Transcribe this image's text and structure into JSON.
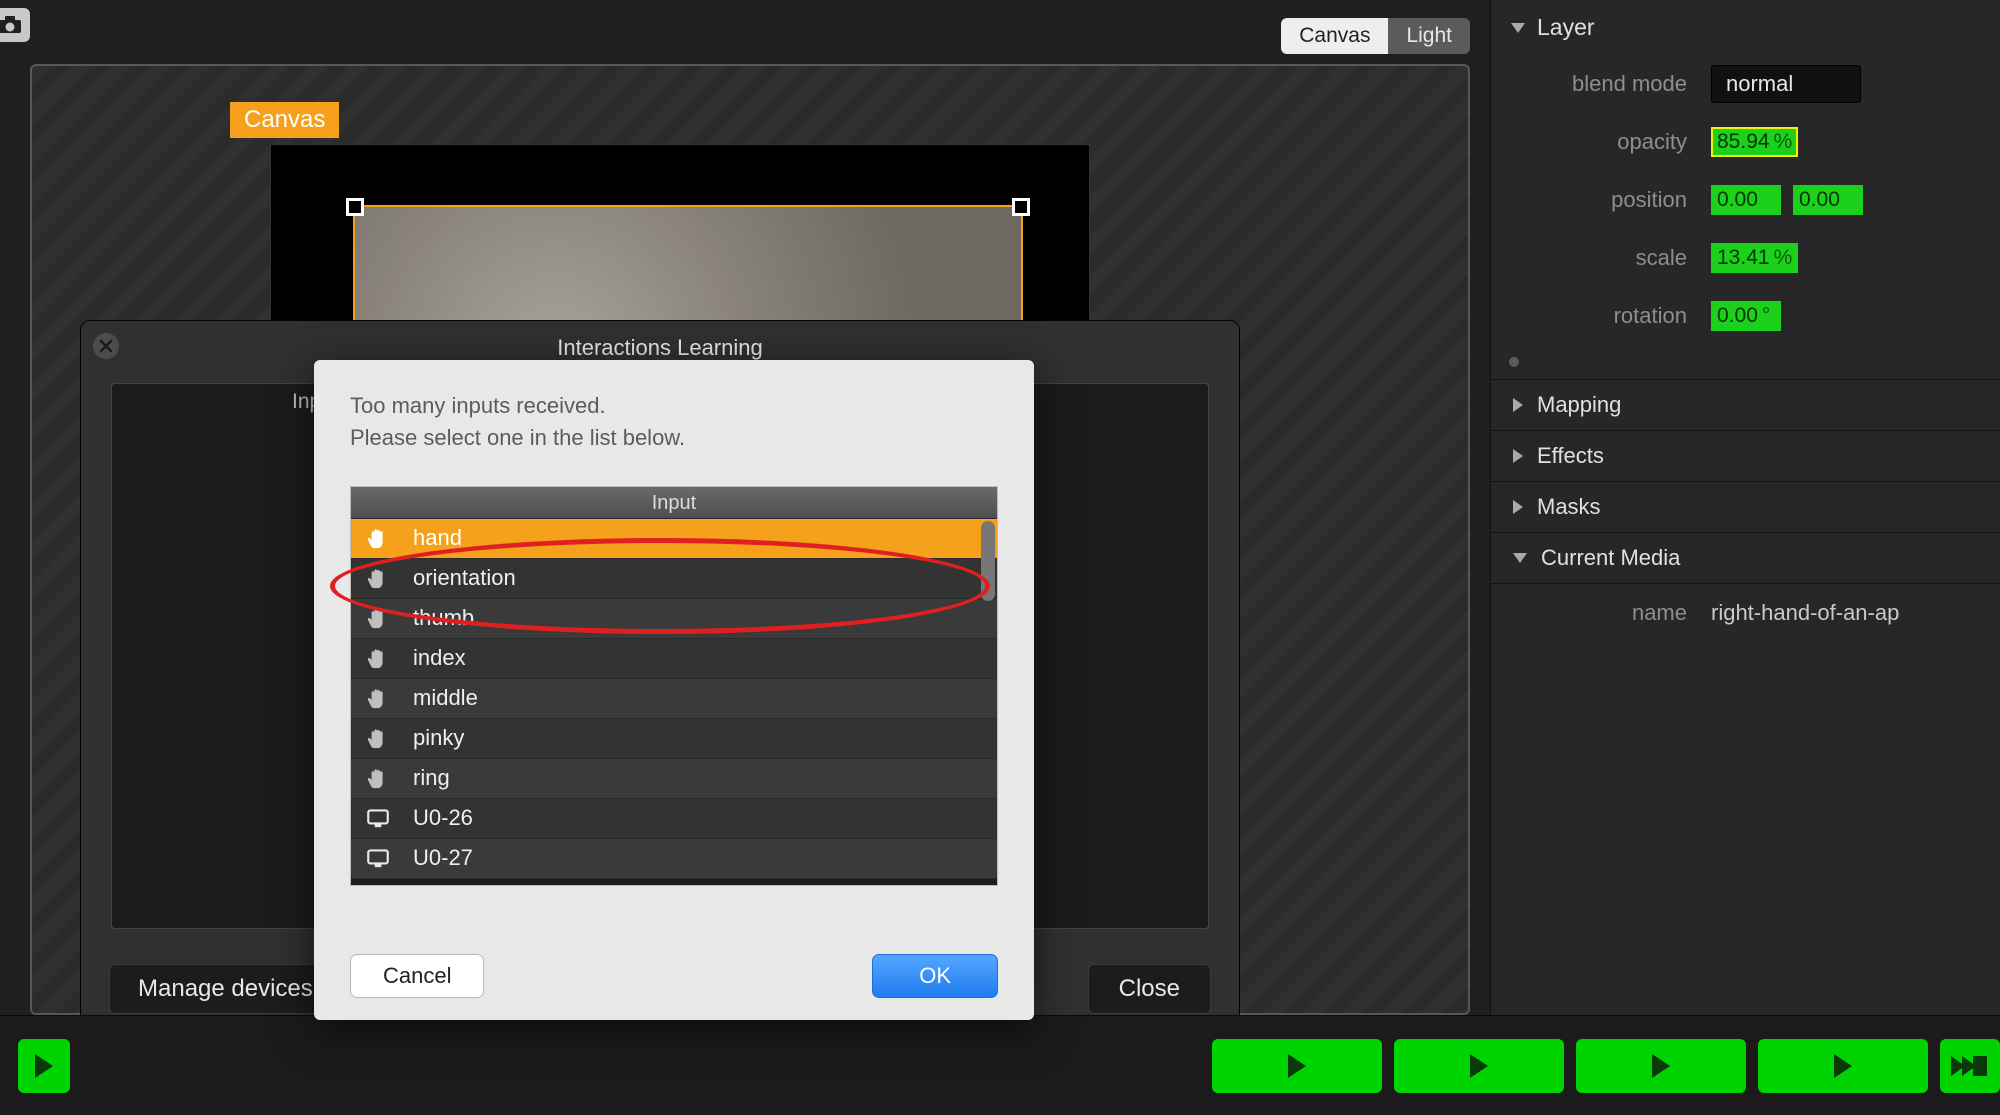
{
  "toolbar": {
    "seg_canvas": "Canvas",
    "seg_light": "Light"
  },
  "canvas": {
    "tag": "Canvas"
  },
  "inspector": {
    "layer_hdr": "Layer",
    "blend_mode_label": "blend mode",
    "blend_mode_value": "normal",
    "opacity_label": "opacity",
    "opacity_value": "85.94",
    "opacity_unit": "%",
    "position_label": "position",
    "position_x": "0.00",
    "position_y": "0.00",
    "scale_label": "scale",
    "scale_value": "13.41",
    "scale_unit": "%",
    "rotation_label": "rotation",
    "rotation_value": "0.00",
    "rotation_unit": "°",
    "mapping": "Mapping",
    "effects": "Effects",
    "masks": "Masks",
    "current_media": "Current Media",
    "media_name_label": "name",
    "media_name_value": "right-hand-of-an-ap"
  },
  "il_panel": {
    "title": "Interactions Learning",
    "col_header": "Inp",
    "manage": "Manage devices ...",
    "close": "Close"
  },
  "modal": {
    "msg_line1": "Too many inputs received.",
    "msg_line2": "Please select one in the list below.",
    "list_header": "Input",
    "cancel": "Cancel",
    "ok": "OK",
    "items": [
      {
        "icon": "hand",
        "label": "hand",
        "selected": true
      },
      {
        "icon": "hand",
        "label": "orientation",
        "selected": false
      },
      {
        "icon": "hand",
        "label": "thumb",
        "selected": false
      },
      {
        "icon": "hand",
        "label": "index",
        "selected": false
      },
      {
        "icon": "hand",
        "label": "middle",
        "selected": false
      },
      {
        "icon": "hand",
        "label": "pinky",
        "selected": false
      },
      {
        "icon": "hand",
        "label": "ring",
        "selected": false
      },
      {
        "icon": "net",
        "label": "U0-26",
        "selected": false
      },
      {
        "icon": "net",
        "label": "U0-27",
        "selected": false
      }
    ]
  }
}
